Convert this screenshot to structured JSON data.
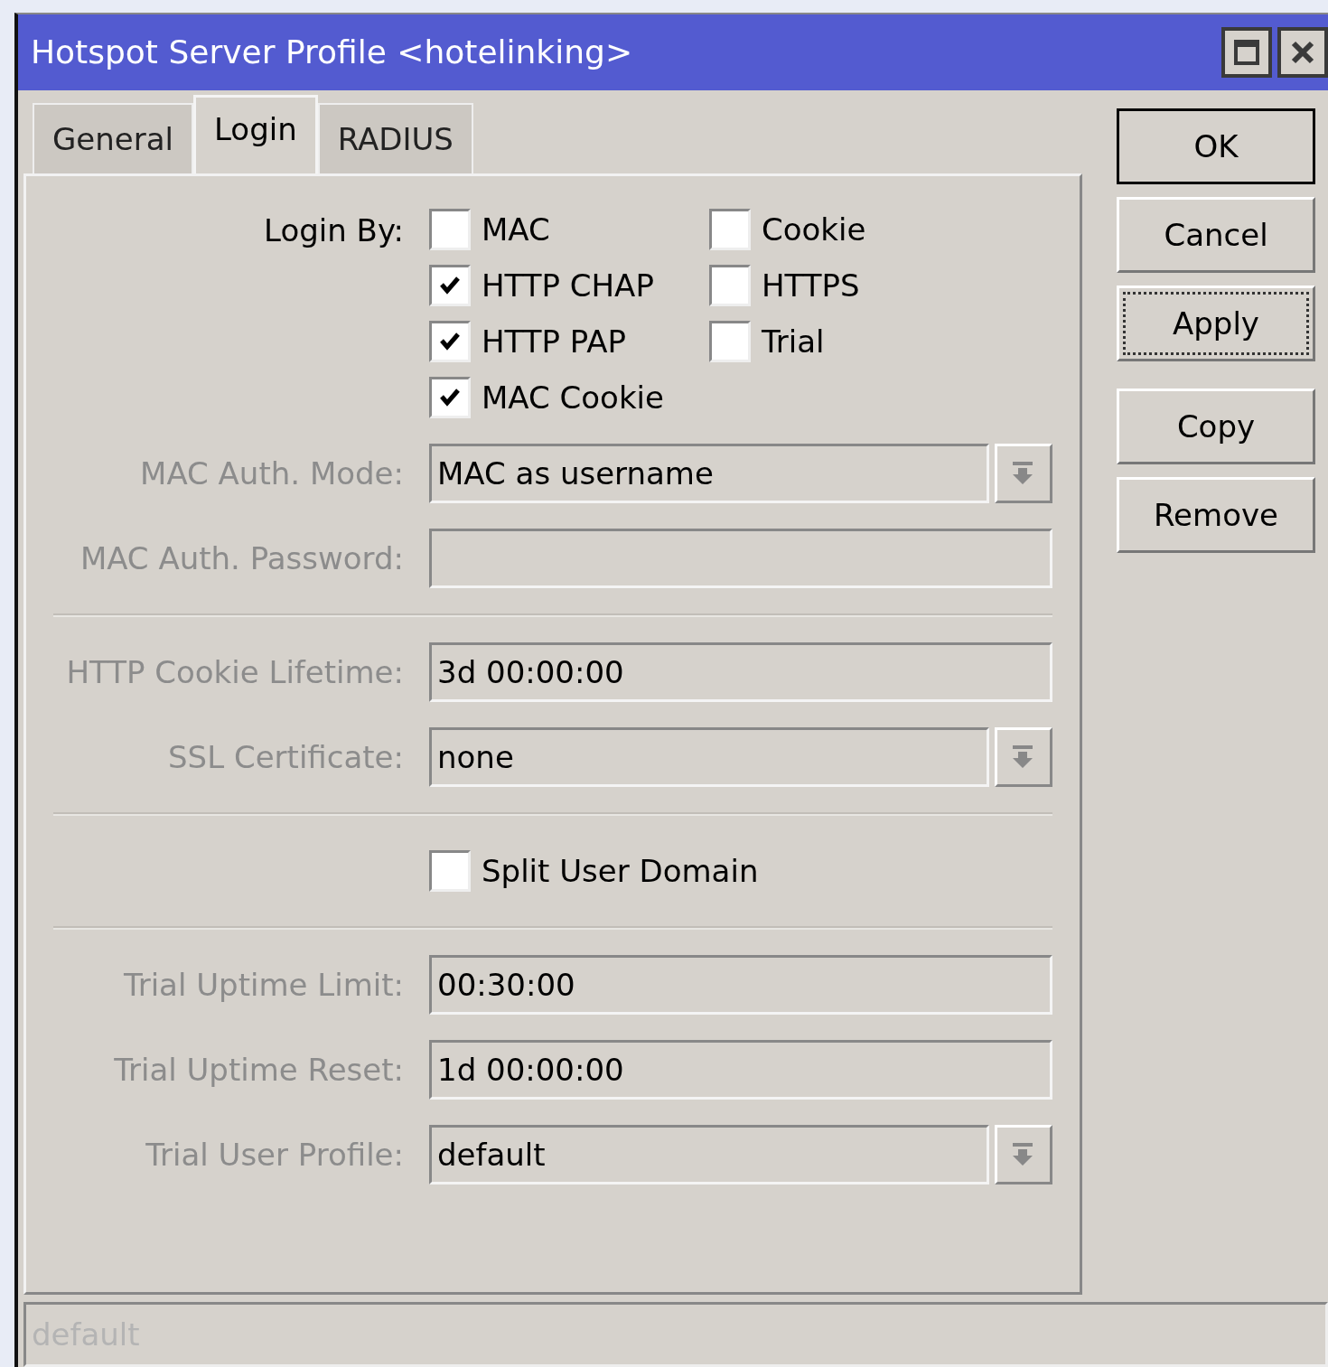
{
  "window": {
    "title": "Hotspot Server Profile <hotelinking>"
  },
  "tabs": [
    {
      "label": "General",
      "selected": false
    },
    {
      "label": "Login",
      "selected": true
    },
    {
      "label": "RADIUS",
      "selected": false
    }
  ],
  "login_by": {
    "label": "Login By:",
    "options": [
      {
        "label": "MAC",
        "checked": false
      },
      {
        "label": "Cookie",
        "checked": false
      },
      {
        "label": "HTTP CHAP",
        "checked": true
      },
      {
        "label": "HTTPS",
        "checked": false
      },
      {
        "label": "HTTP PAP",
        "checked": true
      },
      {
        "label": "Trial",
        "checked": false
      },
      {
        "label": "MAC Cookie",
        "checked": true
      }
    ]
  },
  "fields": [
    {
      "kind": "dropdown",
      "label": "MAC Auth. Mode:",
      "value": "MAC as username",
      "disabled": true
    },
    {
      "kind": "text",
      "label": "MAC Auth. Password:",
      "disabled": true
    },
    {
      "kind": "separator"
    },
    {
      "kind": "text",
      "label": "HTTP Cookie Lifetime:",
      "value": "3d 00:00:00",
      "disabled": true
    },
    {
      "kind": "dropdown",
      "label": "SSL Certificate:",
      "value": "none",
      "disabled": true
    },
    {
      "kind": "separator"
    },
    {
      "kind": "checkbox",
      "label": "Split User Domain",
      "checked": false
    },
    {
      "kind": "separator"
    },
    {
      "kind": "text",
      "label": "Trial Uptime Limit:",
      "value": "00:30:00",
      "disabled": true
    },
    {
      "kind": "text",
      "label": "Trial Uptime Reset:",
      "value": "1d 00:00:00",
      "disabled": true
    },
    {
      "kind": "dropdown",
      "label": "Trial User Profile:",
      "value": "default",
      "disabled": true
    }
  ],
  "button_groups": [
    {
      "buttons": [
        {
          "label": "OK",
          "default": true,
          "focused": false
        },
        {
          "label": "Cancel",
          "default": false,
          "focused": false
        },
        {
          "label": "Apply",
          "default": false,
          "focused": true
        }
      ]
    },
    {
      "buttons": [
        {
          "label": "Copy",
          "default": false,
          "focused": false
        },
        {
          "label": "Remove",
          "default": false,
          "focused": false
        }
      ]
    }
  ],
  "status_bar": {
    "text": "default",
    "disabled": true
  }
}
